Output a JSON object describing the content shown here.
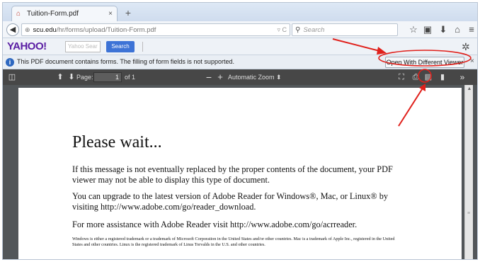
{
  "tab": {
    "title": "Tuition-Form.pdf",
    "close": "×",
    "new_tab": "+"
  },
  "navbar": {
    "back": "◀",
    "url_host": "scu.edu",
    "url_path": "/hr/forms/upload/Tuition-Form.pdf",
    "url_icons": "▿ C",
    "search_placeholder": "Search"
  },
  "yahoo": {
    "logo": "YAHOO!",
    "input_placeholder": "Yahoo Sear",
    "search_label": "Search"
  },
  "notification": {
    "text": "This PDF document contains forms. The filling of form fields is not supported.",
    "button_label": "Open With Different Viewer",
    "close": "×"
  },
  "pdf_toolbar": {
    "page_label": "Page:",
    "page_value": "1",
    "page_of": "of 1",
    "zoom_label": "Automatic Zoom  ⬍"
  },
  "document": {
    "heading": "Please wait...",
    "para1": "If this message is not eventually replaced by the proper contents of the document, your PDF viewer may not be able to display this type of document.",
    "para2": "You can upgrade to the latest version of Adobe Reader for Windows®, Mac, or Linux® by visiting  http://www.adobe.com/go/reader_download.",
    "para3": "For more assistance with Adobe Reader visit  http://www.adobe.com/go/acrreader.",
    "fineprint": "Windows is either a registered trademark or a trademark of Microsoft Corporation in the United States and/or other countries. Mac is a trademark of Apple Inc., registered in the United States and other countries. Linux is the registered trademark of Linus Torvalds in the U.S. and other countries."
  },
  "colors": {
    "annotation_red": "#e0201b",
    "pdf_toolbar": "#474747",
    "yahoo_purple": "#5a1ea3"
  }
}
